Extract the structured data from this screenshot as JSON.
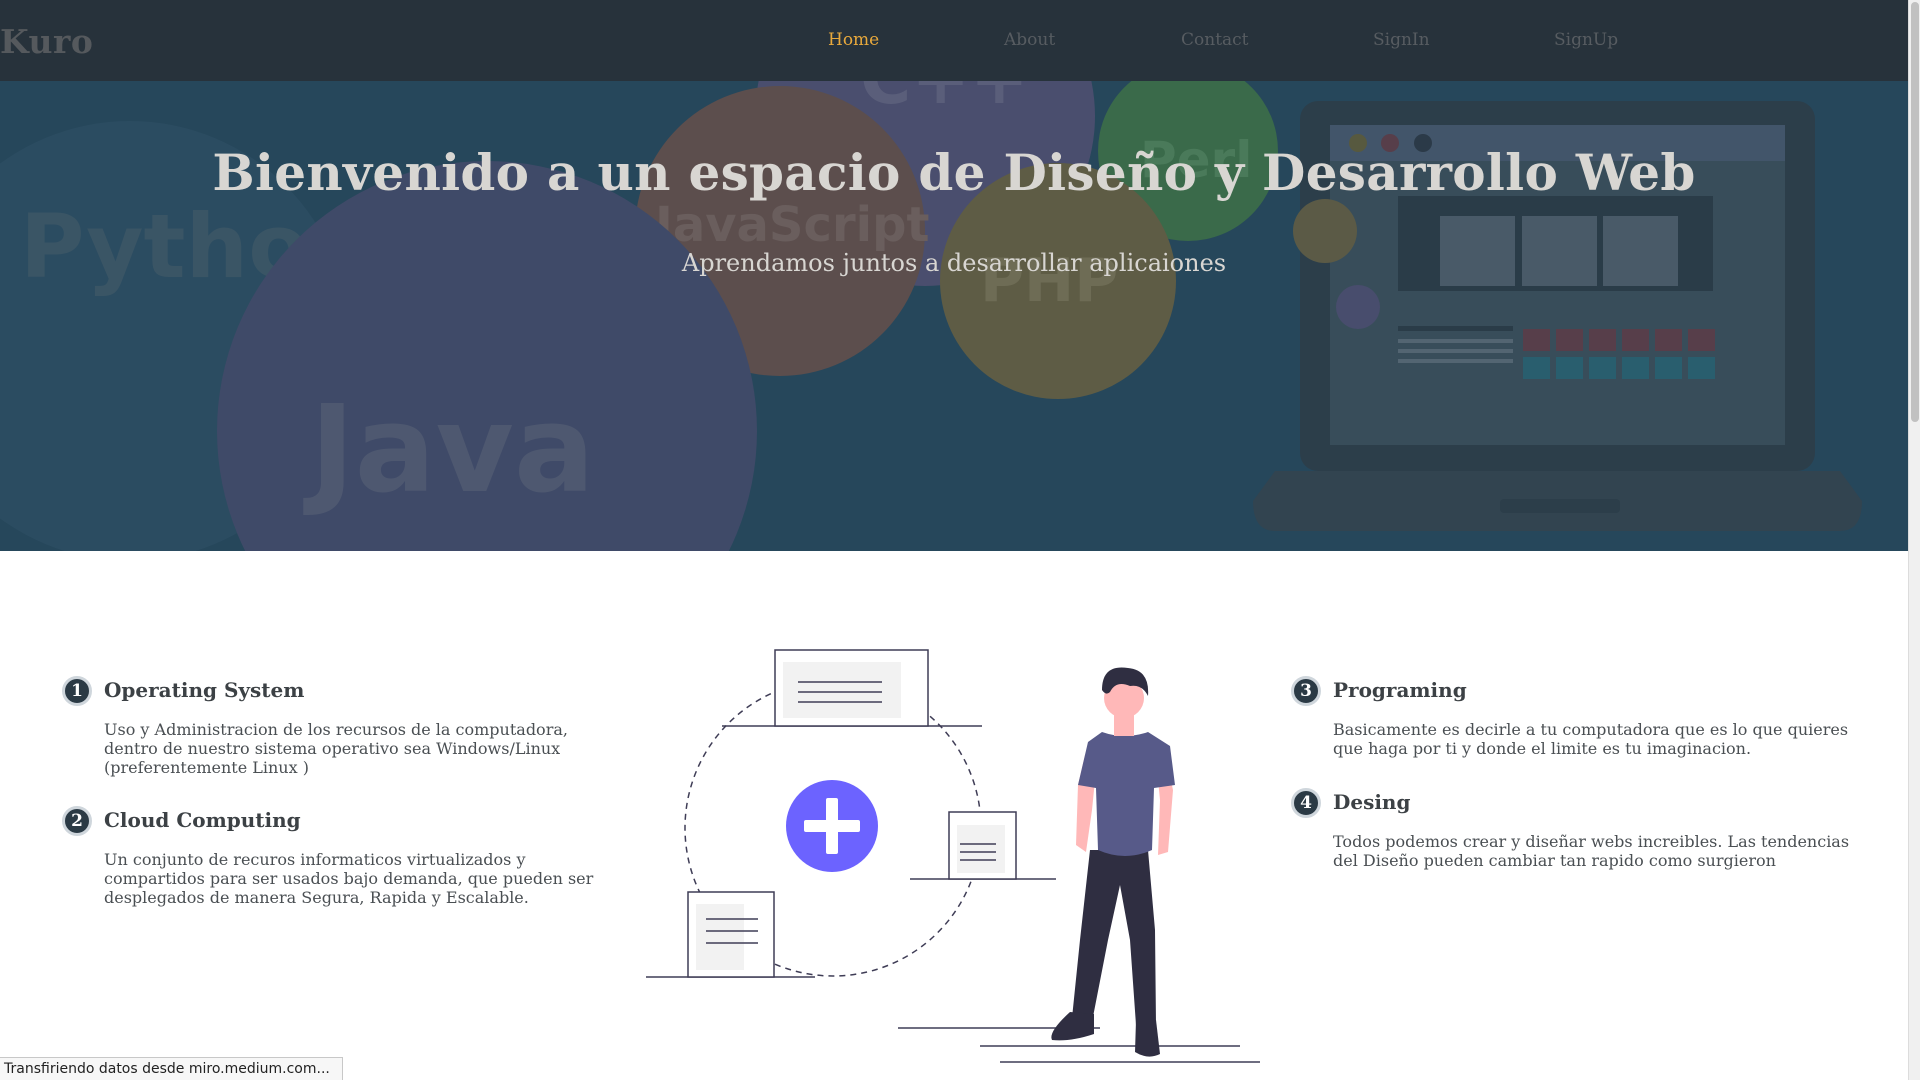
{
  "navbar": {
    "brand": "Kuro",
    "links": [
      {
        "label": "Home",
        "active": true
      },
      {
        "label": "About",
        "active": false
      },
      {
        "label": "Contact",
        "active": false
      },
      {
        "label": "SignIn",
        "active": false
      },
      {
        "label": "SignUp",
        "active": false
      }
    ],
    "active_color": "#e8a93c"
  },
  "hero": {
    "title": "Bienvenido a un espacio de Diseño y Desarrollo Web",
    "subtitle": "Aprendamos juntos a desarrollar aplicaiones",
    "background_words": [
      "Python",
      "Java",
      "JavaScript",
      "PHP",
      "C++",
      "Perl"
    ]
  },
  "features": [
    {
      "number": "1",
      "title": "Operating System",
      "description": "Uso y Administracion de los recursos de la computadora, dentro de nuestro sistema operativo sea Windows/Linux (preferentemente Linux )"
    },
    {
      "number": "2",
      "title": "Cloud Computing",
      "description": "Un conjunto de recuros informaticos virtualizados y compartidos para ser usados bajo demanda, que pueden ser desplegados de manera Segura, Rapida y Escalable."
    },
    {
      "number": "3",
      "title": "Programing",
      "description": "Basicamente es decirle a tu computadora que es lo que quieres que haga por ti y donde el limite es tu imaginacion."
    },
    {
      "number": "4",
      "title": "Desing",
      "description": "Todos podemos crear y diseñar webs increibles. Las tendencias del Diseño pueden cambiar tan rapido como surgieron"
    }
  ],
  "status_bar": {
    "text": "Transfiriendo datos desde miro.medium.com..."
  },
  "colors": {
    "navbar": "#27323b",
    "hero_overlay": "#26475b",
    "illustration_accent": "#6c63ff",
    "shirt": "#575a89"
  }
}
